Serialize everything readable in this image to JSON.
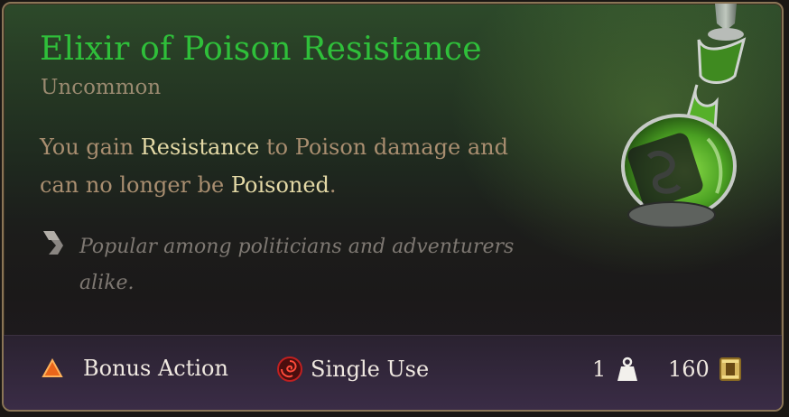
{
  "item": {
    "name": "Elixir of Poison Resistance",
    "rarity": "Uncommon",
    "description": {
      "p1": "You gain ",
      "k1": "Resistance",
      "p2": " to Poison damage and can no longer be ",
      "k2": "Poisoned",
      "p3": "."
    },
    "flavor": "Popular among politicians and adventurers alike."
  },
  "footer": {
    "action": "Bonus Action",
    "use": "Single Use",
    "weight": "1",
    "value": "160"
  },
  "colors": {
    "title": "#2fbf3a",
    "keyword": "#e4d9a6",
    "potion_liquid": "#5fbf2a"
  },
  "icons": {
    "action": "bonus-action-triangle-icon",
    "use": "single-use-swirl-icon",
    "weight": "weight-icon",
    "value": "gold-coin-icon",
    "flavor": "flavor-quote-icon",
    "potion": "potion-bottle-icon"
  }
}
